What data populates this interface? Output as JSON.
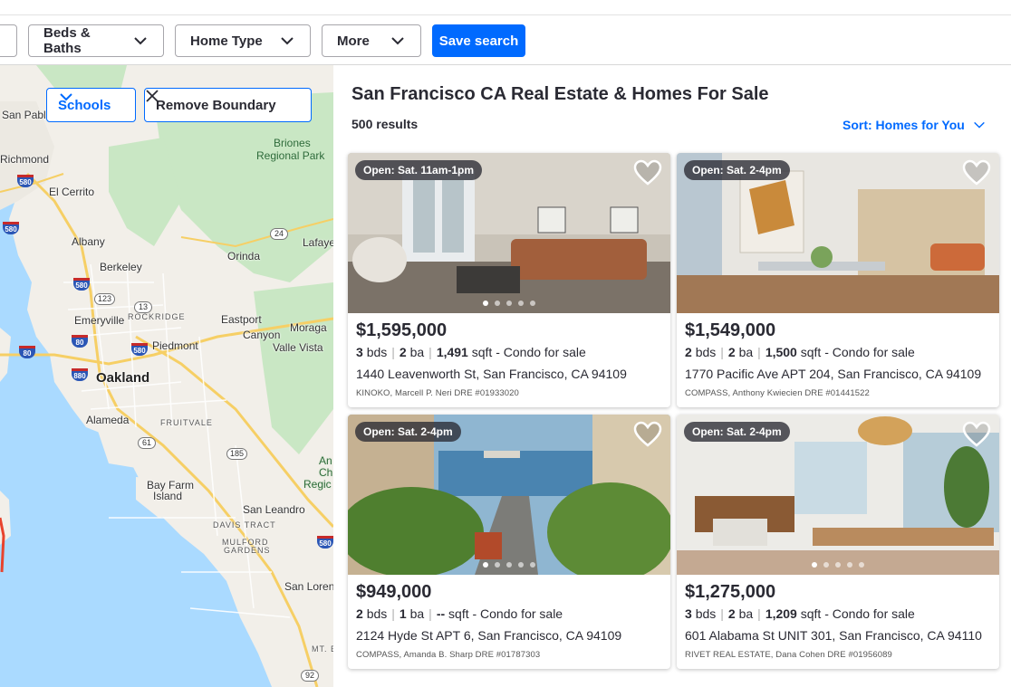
{
  "filters": {
    "beds_baths": "Beds & Baths",
    "home_type": "Home Type",
    "more": "More",
    "save_search": "Save search"
  },
  "map": {
    "schools": "Schools",
    "remove_boundary": "Remove Boundary",
    "labels": {
      "san_pablo": "San Pablo",
      "richmond": "Richmond",
      "el_cerrito": "El Cerrito",
      "albany": "Albany",
      "berkeley": "Berkeley",
      "orinda": "Orinda",
      "lafayette": "Lafaye",
      "briones": "Briones",
      "regional_park": "Regional Park",
      "emeryville": "Emeryville",
      "rockridge": "ROCKRIDGE",
      "eastport": "Eastport",
      "moraga": "Moraga",
      "canyon": "Canyon",
      "valle_vista": "Valle Vista",
      "piedmont": "Piedmont",
      "oakland": "Oakland",
      "alameda": "Alameda",
      "fruitvale": "FRUITVALE",
      "bay_farm_1": "Bay Farm",
      "bay_farm_2": "Island",
      "san_leandro": "San Leandro",
      "davis_tract": "DAVIS TRACT",
      "mulford_1": "MULFORD",
      "mulford_2": "GARDENS",
      "san_lorenzo": "San Loren",
      "mt_eden": "MT. E",
      "an": "An",
      "ch": "Ch",
      "regic": "Regic"
    },
    "shields": [
      "580",
      "580",
      "580",
      "80",
      "580",
      "80",
      "880",
      "580"
    ],
    "ovals": [
      "24",
      "123",
      "13",
      "61",
      "185",
      "92"
    ]
  },
  "results": {
    "title": "San Francisco CA Real Estate & Homes For Sale",
    "count": "500 results",
    "sort": "Sort: Homes for You"
  },
  "listings": [
    {
      "badge": "Open: Sat. 11am-1pm",
      "price": "$1,595,000",
      "beds": "3",
      "beds_unit": "bds",
      "baths": "2",
      "baths_unit": "ba",
      "sqft": "1,491",
      "sqft_unit": "sqft - Condo for sale",
      "address": "1440 Leavenworth St, San Francisco, CA 94109",
      "broker": "KINOKO, Marcell P. Neri DRE #01933020"
    },
    {
      "badge": "Open: Sat. 2-4pm",
      "price": "$1,549,000",
      "beds": "2",
      "beds_unit": "bds",
      "baths": "2",
      "baths_unit": "ba",
      "sqft": "1,500",
      "sqft_unit": "sqft - Condo for sale",
      "address": "1770 Pacific Ave APT 204, San Francisco, CA 94109",
      "broker": "COMPASS, Anthony Kwiecien DRE #01441522"
    },
    {
      "badge": "Open: Sat. 2-4pm",
      "price": "$949,000",
      "beds": "2",
      "beds_unit": "bds",
      "baths": "1",
      "baths_unit": "ba",
      "sqft": "--",
      "sqft_unit": "sqft - Condo for sale",
      "address": "2124 Hyde St APT 6, San Francisco, CA 94109",
      "broker": "COMPASS, Amanda B. Sharp DRE #01787303"
    },
    {
      "badge": "Open: Sat. 2-4pm",
      "price": "$1,275,000",
      "beds": "3",
      "beds_unit": "bds",
      "baths": "2",
      "baths_unit": "ba",
      "sqft": "1,209",
      "sqft_unit": "sqft - Condo for sale",
      "address": "601 Alabama St UNIT 301, San Francisco, CA 94110",
      "broker": "RIVET REAL ESTATE, Dana Cohen DRE #01956089"
    }
  ],
  "colors": {
    "accent": "#006aff",
    "text": "#2a2a33",
    "map_water": "#aadaff",
    "map_land": "#f2efe9",
    "map_park": "#c9e7c4"
  },
  "icons": {
    "dropdown": "chevron-down-icon",
    "close": "close-icon",
    "favorite": "heart-outline-icon"
  }
}
